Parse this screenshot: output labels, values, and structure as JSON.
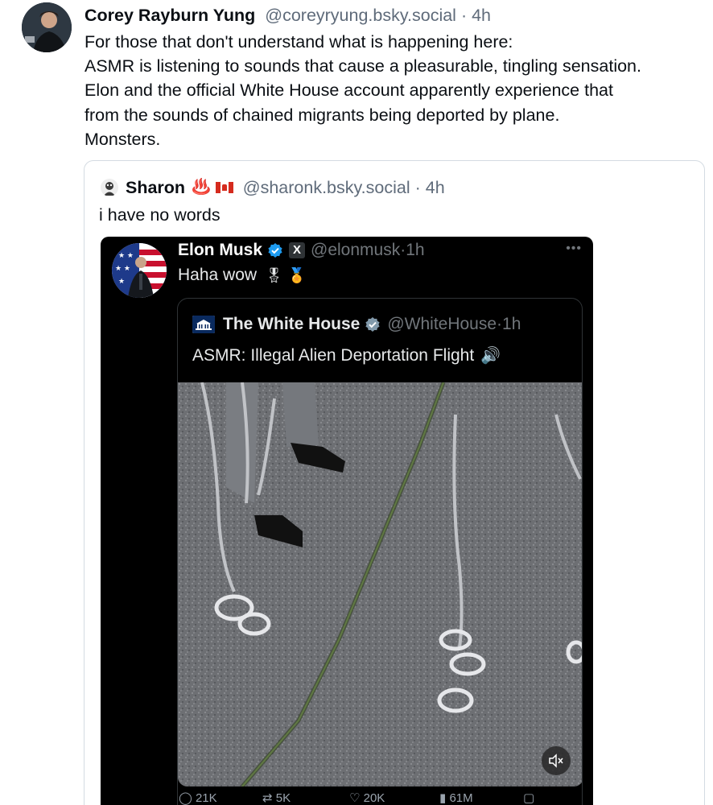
{
  "post": {
    "author_name": "Corey Rayburn Yung",
    "author_handle": "@coreyryung.bsky.social",
    "separator": " · ",
    "time": "4h",
    "lines": [
      "For those that don't understand what is happening here:",
      "ASMR is listening to sounds that cause a pleasurable, tingling sensation.",
      "Elon and the official White House account apparently experience that",
      "from the sounds of chained migrants being deported by plane.",
      "Monsters."
    ]
  },
  "quote": {
    "author_name": "Sharon",
    "emoji": "♨️",
    "author_handle": "@sharonk.bsky.social",
    "separator": "·",
    "time": "4h",
    "text": "i have no words"
  },
  "x_post": {
    "author_name": "Elon Musk",
    "x_badge": "X",
    "author_handle": "@elonmusk",
    "time": "·1h",
    "more": "•••",
    "text": "Haha wow",
    "emoji_a": "🎖",
    "emoji_b": "🏅"
  },
  "wh_post": {
    "author_name": "The White House",
    "author_handle": "@WhiteHouse",
    "time": "·1h",
    "text": "ASMR: Illegal Alien Deportation Flight",
    "speaker": "🔊"
  },
  "metrics": {
    "replies": "21K",
    "reposts": "5K",
    "likes": "20K",
    "views": "61M"
  },
  "colors": {
    "text": "#0b0f14",
    "muted": "#5f6b7a",
    "x_bg": "#000000",
    "x_muted": "#71767b",
    "verified": "#1d9bf0",
    "card_border": "#d4dbe2"
  },
  "icons": {
    "verified": "verified-badge-icon",
    "mute": "mute-icon",
    "more": "more-options-icon",
    "white_house": "white-house-logo-icon"
  }
}
